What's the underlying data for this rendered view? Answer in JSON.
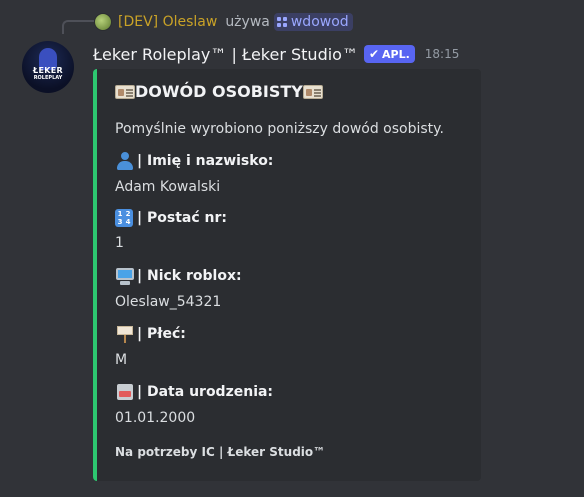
{
  "reply": {
    "username": "[DEV] Oleslaw",
    "uses_text": "używa",
    "command": "wdowod"
  },
  "message": {
    "author": "Łeker Roleplay™ | Łeker Studio™",
    "badge": "APL.",
    "timestamp": "18:15",
    "avatar_logo_line1": "ŁEKER",
    "avatar_logo_line2": "ROLEPLAY"
  },
  "embed": {
    "accent_color": "#2dc770",
    "title": "DOWÓD OSOBISTY",
    "description": "Pomyślnie wyrobiono poniższy dowód osobisty.",
    "fields": [
      {
        "icon": "person-icon",
        "name": "| Imię i nazwisko:",
        "value": "Adam Kowalski"
      },
      {
        "icon": "numbers-icon",
        "name": "| Postać nr:",
        "value": "1"
      },
      {
        "icon": "computer-icon",
        "name": "| Nick roblox:",
        "value": "Oleslaw_54321"
      },
      {
        "icon": "placard-icon",
        "name": "| Płeć:",
        "value": "M"
      },
      {
        "icon": "card-file-box-icon",
        "name": "| Data urodzenia:",
        "value": "01.01.2000"
      }
    ],
    "footer": "Na potrzeby IC | Łeker Studio™"
  }
}
